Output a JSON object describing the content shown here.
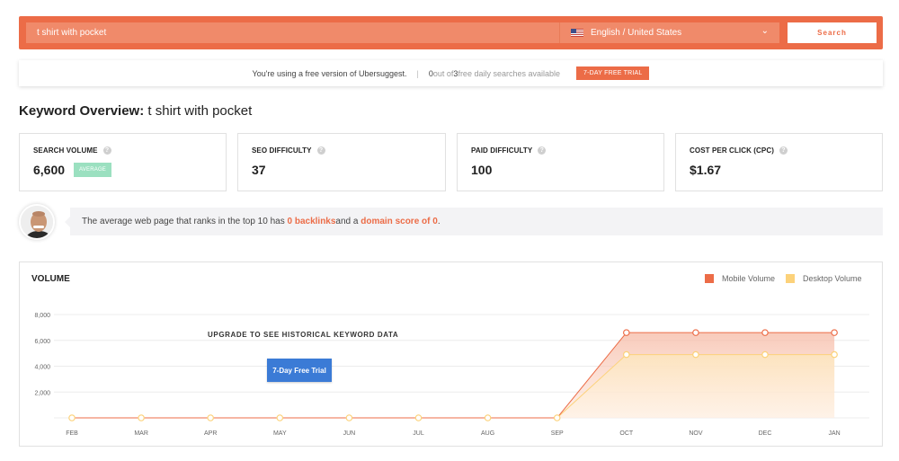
{
  "search": {
    "keyword": "t shirt with pocket",
    "locale": "English / United States",
    "button_label": "Search"
  },
  "notice": {
    "message": "You're using a free version of Ubersuggest.",
    "separator": "|",
    "used": "0",
    "out_of": " out of ",
    "limit": "3",
    "suffix": " free daily searches available",
    "trial_label": "7-DAY FREE TRIAL"
  },
  "overview": {
    "title_label": "Keyword Overview:",
    "keyword": "t shirt with pocket"
  },
  "metrics": [
    {
      "label": "SEARCH VOLUME",
      "value": "6,600",
      "badge": "AVERAGE"
    },
    {
      "label": "SEO DIFFICULTY",
      "value": "37"
    },
    {
      "label": "PAID DIFFICULTY",
      "value": "100"
    },
    {
      "label": "COST PER CLICK (CPC)",
      "value": "$1.67"
    }
  ],
  "tip": {
    "prefix": "The average web page that ranks in the top 10 has ",
    "backlinks": "0 backlinks",
    "middle": " and a ",
    "domain_score": "domain score of 0",
    "suffix": "."
  },
  "volume": {
    "title": "VOLUME",
    "upgrade_message": "UPGRADE TO SEE HISTORICAL KEYWORD DATA",
    "trial_button": "7-Day Free Trial"
  },
  "colors": {
    "brand": "#ec6c47",
    "mobile": "#ec6c47",
    "desktop": "#fcd27a",
    "average_badge": "#9be0c0",
    "trial_button": "#3b7bd6"
  },
  "icons": [
    "us-flag-icon",
    "chevron-down-icon",
    "question-icon",
    "avatar-image"
  ],
  "chart_data": {
    "type": "area",
    "categories": [
      "FEB",
      "MAR",
      "APR",
      "MAY",
      "JUN",
      "JUL",
      "AUG",
      "SEP",
      "OCT",
      "NOV",
      "DEC",
      "JAN"
    ],
    "y_ticks": [
      "2,000",
      "4,000",
      "6,000",
      "8,000"
    ],
    "ylim": [
      0,
      8000
    ],
    "grid": true,
    "legend_position": "top-right",
    "series": [
      {
        "name": "Mobile Volume",
        "values": [
          0,
          0,
          0,
          0,
          0,
          0,
          0,
          0,
          6600,
          6600,
          6600,
          6600
        ]
      },
      {
        "name": "Desktop Volume",
        "values": [
          0,
          0,
          0,
          0,
          0,
          0,
          0,
          0,
          4900,
          4900,
          4900,
          4900
        ]
      }
    ]
  }
}
